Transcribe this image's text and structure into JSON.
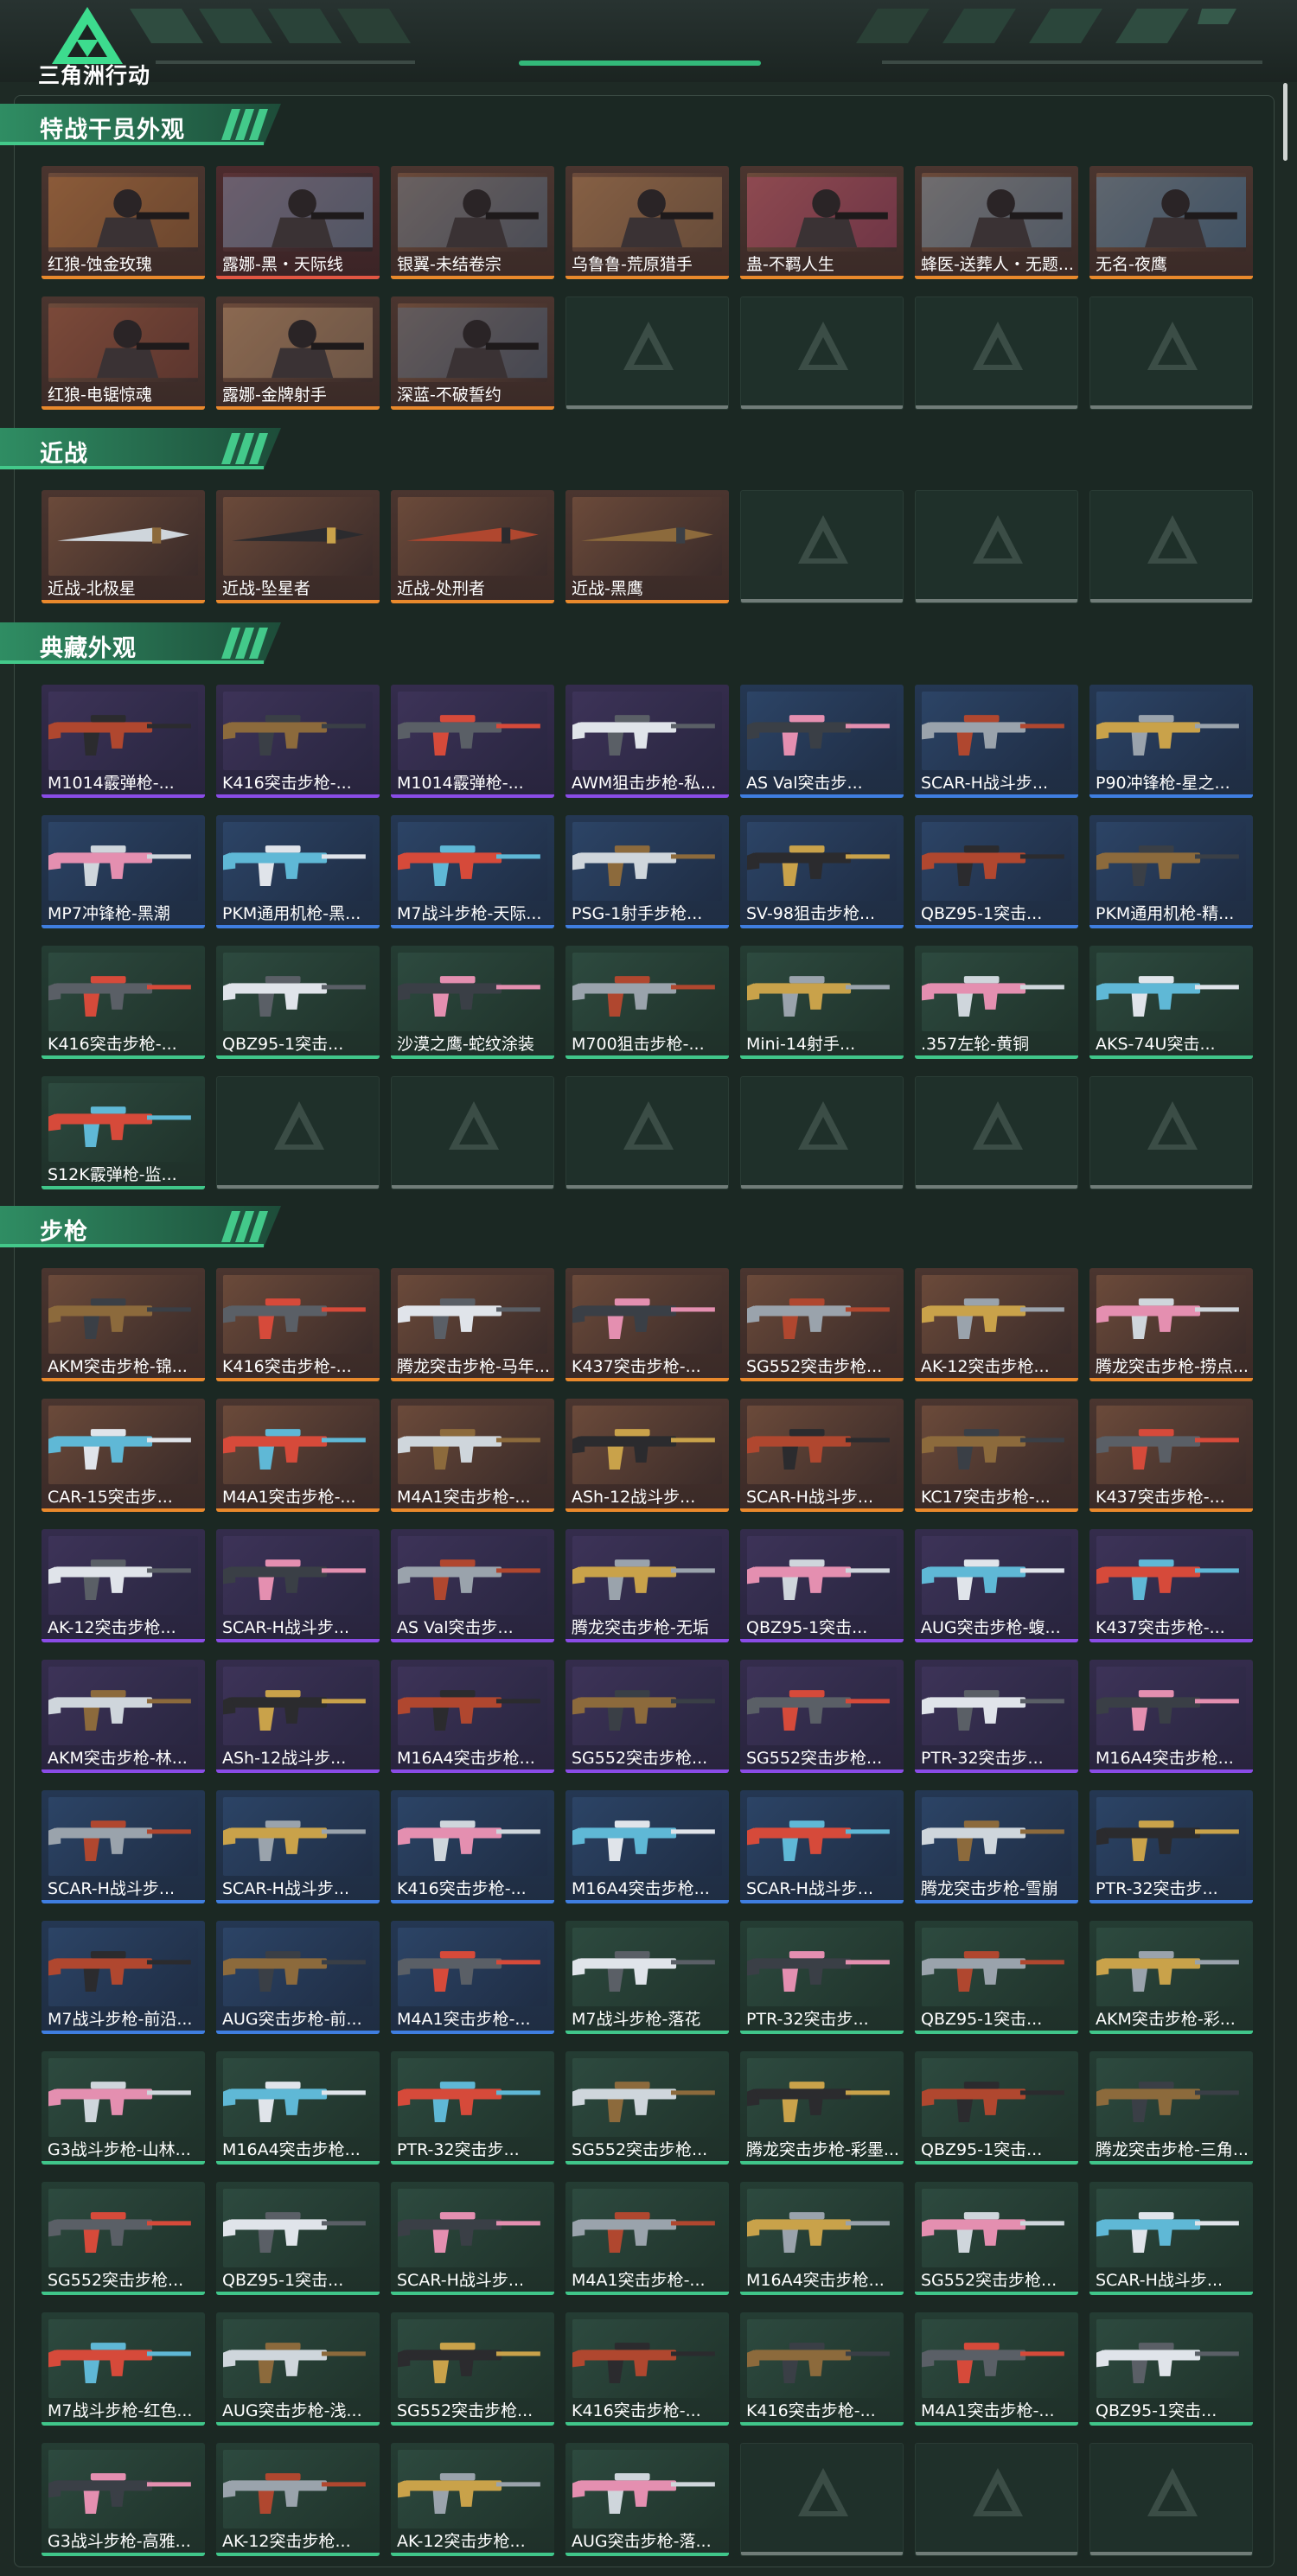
{
  "header": {
    "brand": "三角洲行动"
  },
  "sections": [
    {
      "title": "特战干员外观",
      "items": [
        {
          "label": "红狼-蚀金玫瑰",
          "quality": "orange"
        },
        {
          "label": "露娜-黑・天际线",
          "quality": "red"
        },
        {
          "label": "银翼-未结卷宗",
          "quality": "orange"
        },
        {
          "label": "乌鲁鲁-荒原猎手",
          "quality": "orange"
        },
        {
          "label": "蛊-不羁人生",
          "quality": "orange"
        },
        {
          "label": "蜂医-送葬人・无题...",
          "quality": "orange"
        },
        {
          "label": "无名-夜鹰",
          "quality": "orange"
        },
        {
          "label": "红狼-电锯惊魂",
          "quality": "orange"
        },
        {
          "label": "露娜-金牌射手",
          "quality": "orange"
        },
        {
          "label": "深蓝-不破誓约",
          "quality": "orange"
        },
        {
          "empty": true
        },
        {
          "empty": true
        },
        {
          "empty": true
        },
        {
          "empty": true
        }
      ]
    },
    {
      "title": "近战",
      "items": [
        {
          "label": "近战-北极星",
          "quality": "orange"
        },
        {
          "label": "近战-坠星者",
          "quality": "orange"
        },
        {
          "label": "近战-处刑者",
          "quality": "orange"
        },
        {
          "label": "近战-黑鹰",
          "quality": "orange"
        },
        {
          "empty": true
        },
        {
          "empty": true
        },
        {
          "empty": true
        }
      ]
    },
    {
      "title": "典藏外观",
      "items": [
        {
          "label": "M1014霰弹枪-...",
          "quality": "purple"
        },
        {
          "label": "K416突击步枪-...",
          "quality": "purple"
        },
        {
          "label": "M1014霰弹枪-...",
          "quality": "purple"
        },
        {
          "label": "AWM狙击步枪-私...",
          "quality": "purple"
        },
        {
          "label": "AS Val突击步...",
          "quality": "blue"
        },
        {
          "label": "SCAR-H战斗步...",
          "quality": "blue"
        },
        {
          "label": "P90冲锋枪-星之...",
          "quality": "blue"
        },
        {
          "label": "MP7冲锋枪-黑潮",
          "quality": "blue"
        },
        {
          "label": "PKM通用机枪-黑...",
          "quality": "blue"
        },
        {
          "label": "M7战斗步枪-天际...",
          "quality": "blue"
        },
        {
          "label": "PSG-1射手步枪...",
          "quality": "blue"
        },
        {
          "label": "SV-98狙击步枪...",
          "quality": "blue"
        },
        {
          "label": "QBZ95-1突击...",
          "quality": "blue"
        },
        {
          "label": "PKM通用机枪-精...",
          "quality": "blue"
        },
        {
          "label": "K416突击步枪-...",
          "quality": "green"
        },
        {
          "label": "QBZ95-1突击...",
          "quality": "green"
        },
        {
          "label": "沙漠之鹰-蛇纹涂装",
          "quality": "green"
        },
        {
          "label": "M700狙击步枪-...",
          "quality": "green"
        },
        {
          "label": "Mini-14射手...",
          "quality": "green"
        },
        {
          "label": ".357左轮-黄铜",
          "quality": "green"
        },
        {
          "label": "AKS-74U突击...",
          "quality": "green"
        },
        {
          "label": "S12K霰弹枪-监...",
          "quality": "green"
        },
        {
          "empty": true
        },
        {
          "empty": true
        },
        {
          "empty": true
        },
        {
          "empty": true
        },
        {
          "empty": true
        },
        {
          "empty": true
        }
      ]
    },
    {
      "title": "步枪",
      "items": [
        {
          "label": "AKM突击步枪-锦...",
          "quality": "orange"
        },
        {
          "label": "K416突击步枪-...",
          "quality": "orange"
        },
        {
          "label": "腾龙突击步枪-马年...",
          "quality": "orange"
        },
        {
          "label": "K437突击步枪-...",
          "quality": "orange"
        },
        {
          "label": "SG552突击步枪...",
          "quality": "orange"
        },
        {
          "label": "AK-12突击步枪...",
          "quality": "orange"
        },
        {
          "label": "腾龙突击步枪-捞点...",
          "quality": "orange"
        },
        {
          "label": "CAR-15突击步...",
          "quality": "orange"
        },
        {
          "label": "M4A1突击步枪-...",
          "quality": "orange"
        },
        {
          "label": "M4A1突击步枪-...",
          "quality": "orange"
        },
        {
          "label": "ASh-12战斗步...",
          "quality": "orange"
        },
        {
          "label": "SCAR-H战斗步...",
          "quality": "orange"
        },
        {
          "label": "KC17突击步枪-...",
          "quality": "orange"
        },
        {
          "label": "K437突击步枪-...",
          "quality": "orange"
        },
        {
          "label": "AK-12突击步枪...",
          "quality": "purple"
        },
        {
          "label": "SCAR-H战斗步...",
          "quality": "purple"
        },
        {
          "label": "AS Val突击步...",
          "quality": "purple"
        },
        {
          "label": "腾龙突击步枪-无垢",
          "quality": "purple"
        },
        {
          "label": "QBZ95-1突击...",
          "quality": "purple"
        },
        {
          "label": "AUG突击步枪-蝮...",
          "quality": "purple"
        },
        {
          "label": "K437突击步枪-...",
          "quality": "purple"
        },
        {
          "label": "AKM突击步枪-林...",
          "quality": "purple"
        },
        {
          "label": "ASh-12战斗步...",
          "quality": "purple"
        },
        {
          "label": "M16A4突击步枪...",
          "quality": "purple"
        },
        {
          "label": "SG552突击步枪...",
          "quality": "purple"
        },
        {
          "label": "SG552突击步枪...",
          "quality": "purple"
        },
        {
          "label": "PTR-32突击步...",
          "quality": "purple"
        },
        {
          "label": "M16A4突击步枪...",
          "quality": "purple"
        },
        {
          "label": "SCAR-H战斗步...",
          "quality": "blue"
        },
        {
          "label": "SCAR-H战斗步...",
          "quality": "blue"
        },
        {
          "label": "K416突击步枪-...",
          "quality": "blue"
        },
        {
          "label": "M16A4突击步枪...",
          "quality": "blue"
        },
        {
          "label": "SCAR-H战斗步...",
          "quality": "blue"
        },
        {
          "label": "腾龙突击步枪-雪崩",
          "quality": "blue"
        },
        {
          "label": "PTR-32突击步...",
          "quality": "blue"
        },
        {
          "label": "M7战斗步枪-前沿...",
          "quality": "blue"
        },
        {
          "label": "AUG突击步枪-前...",
          "quality": "blue"
        },
        {
          "label": "M4A1突击步枪-...",
          "quality": "blue"
        },
        {
          "label": "M7战斗步枪-落花",
          "quality": "green"
        },
        {
          "label": "PTR-32突击步...",
          "quality": "green"
        },
        {
          "label": "QBZ95-1突击...",
          "quality": "green"
        },
        {
          "label": "AKM突击步枪-彩...",
          "quality": "green"
        },
        {
          "label": "G3战斗步枪-山林...",
          "quality": "green"
        },
        {
          "label": "M16A4突击步枪...",
          "quality": "green"
        },
        {
          "label": "PTR-32突击步...",
          "quality": "green"
        },
        {
          "label": "SG552突击步枪...",
          "quality": "green"
        },
        {
          "label": "腾龙突击步枪-彩墨...",
          "quality": "green"
        },
        {
          "label": "QBZ95-1突击...",
          "quality": "green"
        },
        {
          "label": "腾龙突击步枪-三角...",
          "quality": "green"
        },
        {
          "label": "SG552突击步枪...",
          "quality": "green"
        },
        {
          "label": "QBZ95-1突击...",
          "quality": "green"
        },
        {
          "label": "SCAR-H战斗步...",
          "quality": "green"
        },
        {
          "label": "M4A1突击步枪-...",
          "quality": "green"
        },
        {
          "label": "M16A4突击步枪...",
          "quality": "green"
        },
        {
          "label": "SG552突击步枪...",
          "quality": "green"
        },
        {
          "label": "SCAR-H战斗步...",
          "quality": "green"
        },
        {
          "label": "M7战斗步枪-红色...",
          "quality": "green"
        },
        {
          "label": "AUG突击步枪-浅...",
          "quality": "green"
        },
        {
          "label": "SG552突击步枪...",
          "quality": "green"
        },
        {
          "label": "K416突击步枪-...",
          "quality": "green"
        },
        {
          "label": "K416突击步枪-...",
          "quality": "green"
        },
        {
          "label": "M4A1突击步枪-...",
          "quality": "green"
        },
        {
          "label": "QBZ95-1突击...",
          "quality": "green"
        },
        {
          "label": "G3战斗步枪-高雅...",
          "quality": "green"
        },
        {
          "label": "AK-12突击步枪...",
          "quality": "green"
        },
        {
          "label": "AK-12突击步枪...",
          "quality": "green"
        },
        {
          "label": "AUG突击步枪-落...",
          "quality": "green"
        },
        {
          "empty": true
        },
        {
          "empty": true
        },
        {
          "empty": true
        }
      ]
    }
  ],
  "colors": {
    "accent": "#43c98a",
    "orange": "#e9892c",
    "red": "#e25643",
    "purple": "#8a4ce6",
    "blue": "#3f7ee0",
    "green": "#40c68a"
  }
}
